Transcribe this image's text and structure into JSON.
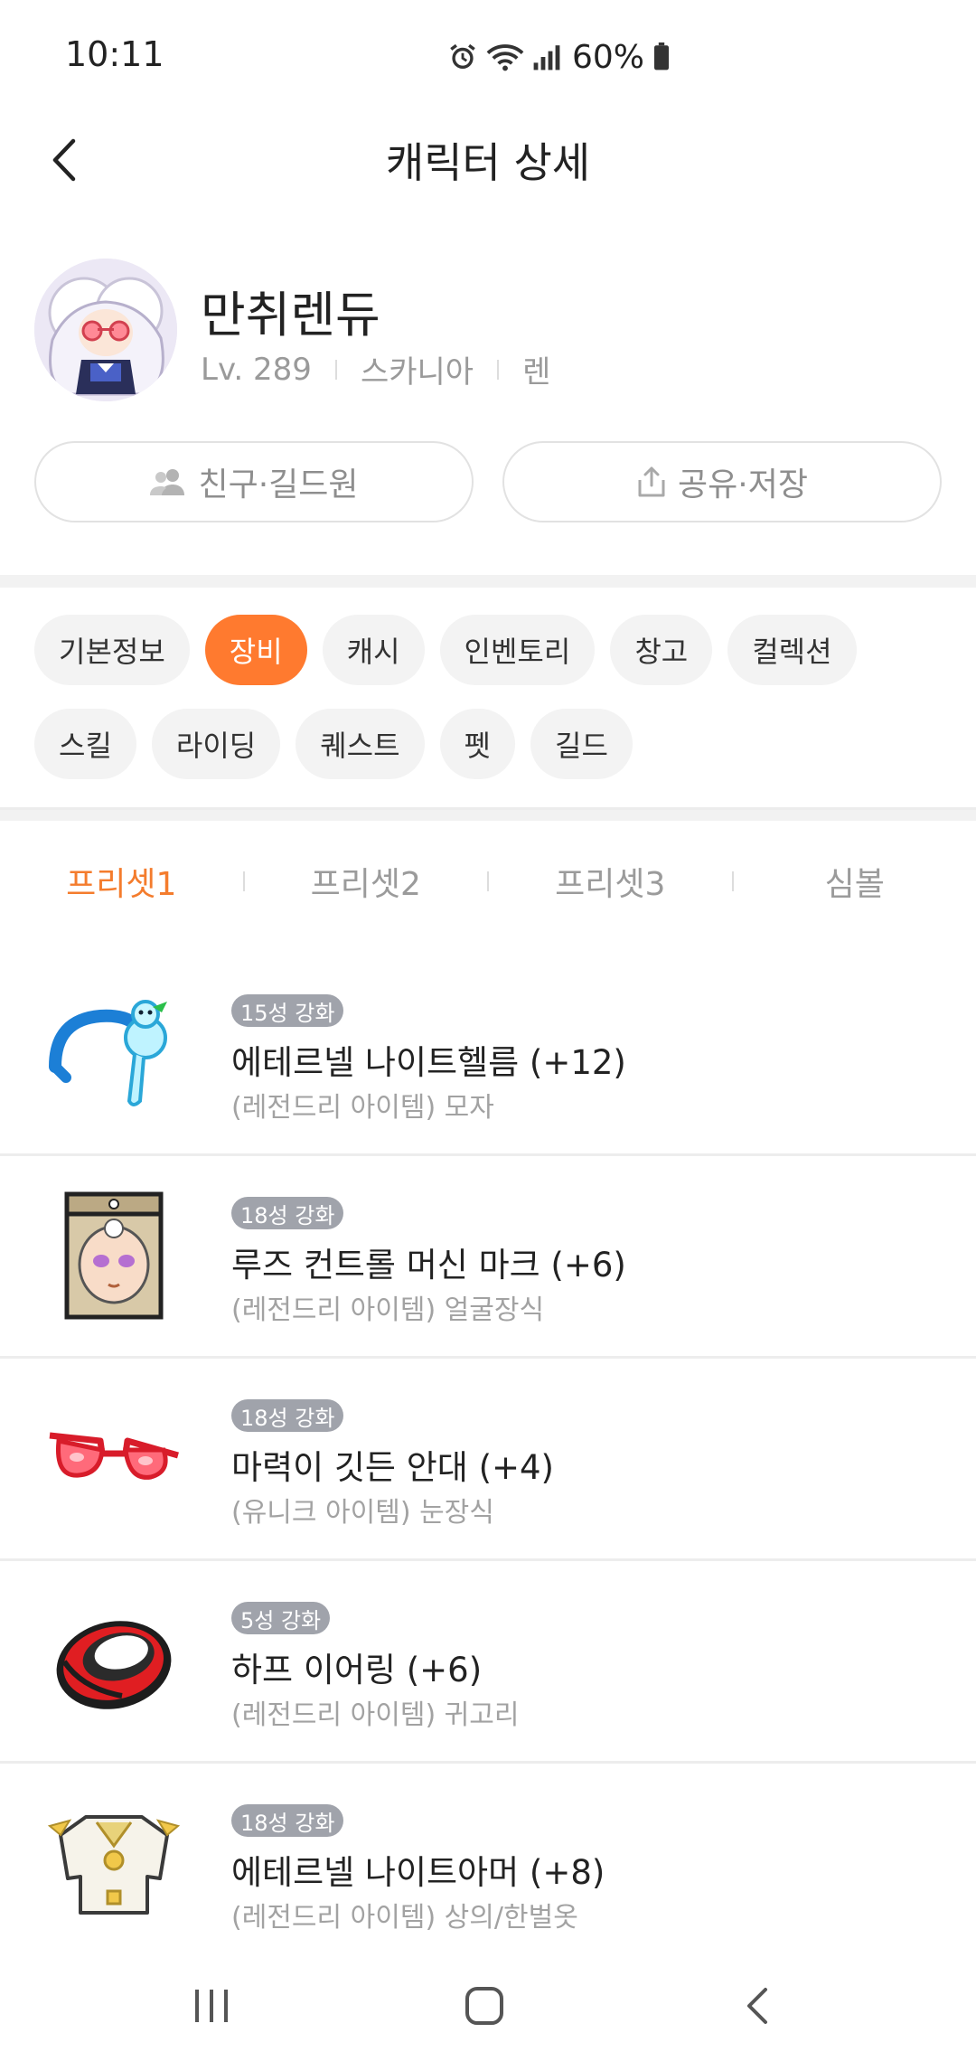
{
  "status": {
    "time": "10:11",
    "battery": "60%"
  },
  "header": {
    "title": "캐릭터 상세"
  },
  "profile": {
    "name": "만취렌듀",
    "level": "Lv. 289",
    "world": "스카니아",
    "job": "렌"
  },
  "actions": {
    "friends_label": "친구·길드원",
    "share_label": "공유·저장"
  },
  "tabs": [
    "기본정보",
    "장비",
    "캐시",
    "인벤토리",
    "창고",
    "컬렉션",
    "스킬",
    "라이딩",
    "퀘스트",
    "펫",
    "길드"
  ],
  "active_tab": "장비",
  "presets": [
    "프리셋1",
    "프리셋2",
    "프리셋3",
    "심볼"
  ],
  "active_preset": "프리셋1",
  "items": [
    {
      "badge": "15성 강화",
      "name": "에테르넬 나이트헬름 (+12)",
      "type": "(레전드리 아이템) 모자",
      "icon": "helmet-icon"
    },
    {
      "badge": "18성 강화",
      "name": "루즈 컨트롤 머신 마크 (+6)",
      "type": "(레전드리 아이템) 얼굴장식",
      "icon": "face-accessory-icon"
    },
    {
      "badge": "18성 강화",
      "name": "마력이 깃든 안대 (+4)",
      "type": "(유니크 아이템) 눈장식",
      "icon": "eye-accessory-icon"
    },
    {
      "badge": "5성 강화",
      "name": "하프 이어링 (+6)",
      "type": "(레전드리 아이템) 귀고리",
      "icon": "earring-icon"
    },
    {
      "badge": "18성 강화",
      "name": "에테르넬 나이트아머 (+8)",
      "type": "(레전드리 아이템) 상의/한벌옷",
      "icon": "armor-icon"
    }
  ],
  "colors": {
    "accent": "#ff7a2f",
    "preset_active": "#f47c2d",
    "badge": "#a0a3ab"
  }
}
